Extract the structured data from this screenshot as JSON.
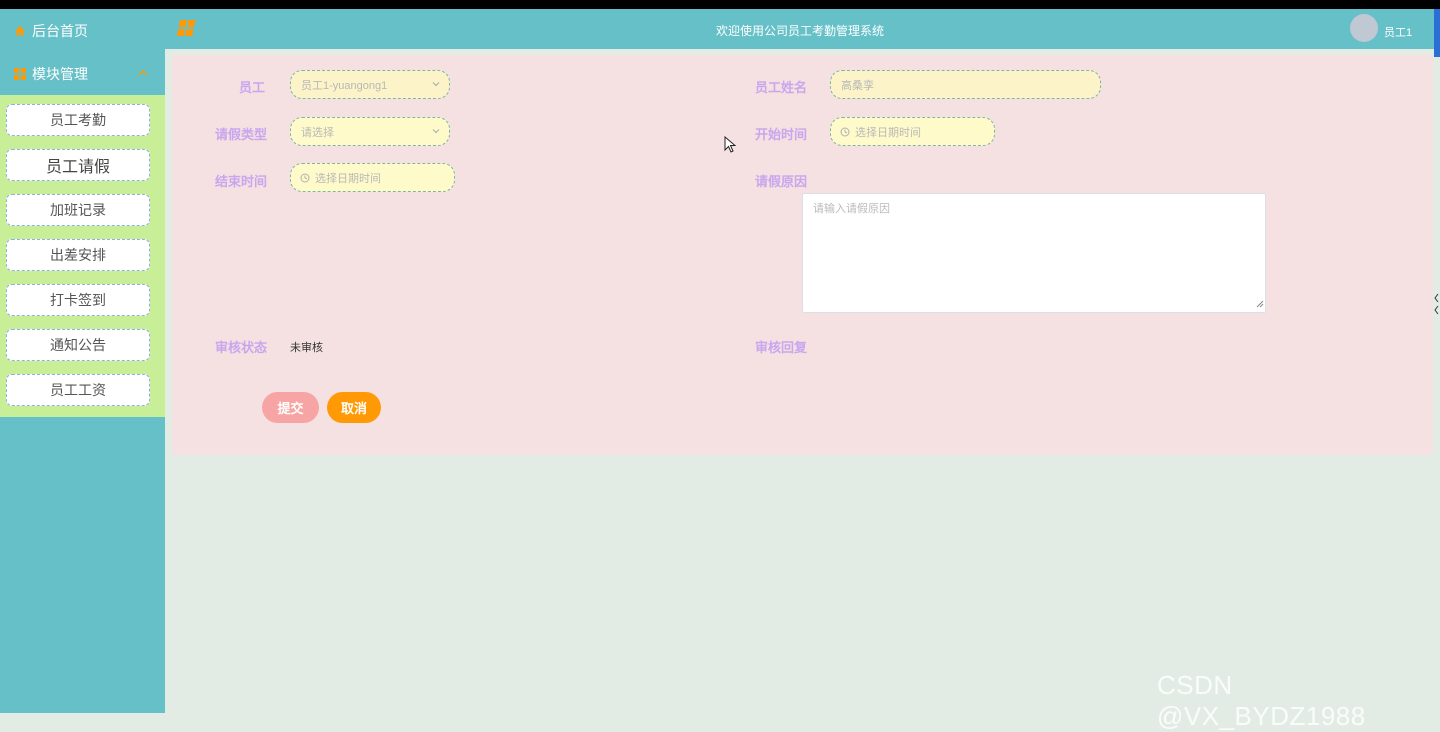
{
  "header": {
    "title": "欢迎使用公司员工考勤管理系统",
    "user_name": "员工1"
  },
  "sidebar": {
    "home_label": "后台首页",
    "module_label": "模块管理",
    "items": [
      {
        "label": "员工考勤"
      },
      {
        "label": "员工请假",
        "active": true
      },
      {
        "label": "加班记录"
      },
      {
        "label": "出差安排"
      },
      {
        "label": "打卡签到"
      },
      {
        "label": "通知公告"
      },
      {
        "label": "员工工资"
      }
    ]
  },
  "form": {
    "employee": {
      "label": "员工",
      "value": "员工1-yuangong1"
    },
    "employee_name": {
      "label": "员工姓名",
      "value": "高桑孪"
    },
    "leave_type": {
      "label": "请假类型",
      "placeholder": "请选择"
    },
    "start_time": {
      "label": "开始时间",
      "placeholder": "选择日期时间"
    },
    "end_time": {
      "label": "结束时间",
      "placeholder": "选择日期时间"
    },
    "leave_reason": {
      "label": "请假原因",
      "placeholder": "请输入请假原因"
    },
    "review_status": {
      "label": "审核状态",
      "value": "未审核"
    },
    "review_reply": {
      "label": "审核回复"
    },
    "submit_label": "提交",
    "cancel_label": "取消"
  },
  "watermark": "CSDN @VX_BYDZ1988",
  "colors": {
    "teal": "#66c0c8",
    "submenu_bg": "#c8ee98",
    "panel_bg": "#f5e1e1",
    "label": "#c9a6ee",
    "submit": "#f7a4a4",
    "cancel": "#ff9a06"
  },
  "icons": {
    "home": "home-icon",
    "module": "grid-icon",
    "logo": "logo-grid-icon",
    "clock": "clock-icon",
    "caret": "chevron-down-icon"
  }
}
